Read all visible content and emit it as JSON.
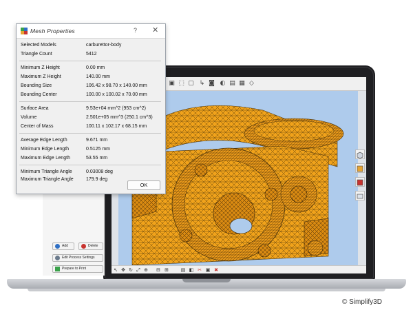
{
  "dialog": {
    "title": "Mesh Properties",
    "help_label": "?",
    "close_label": "✕",
    "ok_label": "OK",
    "rows": [
      {
        "label": "Selected Models",
        "value": "carburettor-body"
      },
      {
        "label": "Triangle Count",
        "value": "5412"
      },
      {
        "label": "Minimum Z Height",
        "value": "0.00 mm"
      },
      {
        "label": "Maximum Z Height",
        "value": "140.00 mm"
      },
      {
        "label": "Bounding Size",
        "value": "106.42 x 98.70 x 140.00 mm"
      },
      {
        "label": "Bounding Center",
        "value": "100.00 x 100.02 x 70.00 mm"
      },
      {
        "label": "Surface Area",
        "value": "9.53e+04 mm^2 (953 cm^2)"
      },
      {
        "label": "Volume",
        "value": "2.501e+05 mm^3 (250.1 cm^3)"
      },
      {
        "label": "Center of Mass",
        "value": "100.11 x 102.17 x 68.15 mm"
      },
      {
        "label": "Average Edge Length",
        "value": "9.671 mm"
      },
      {
        "label": "Minimum Edge Length",
        "value": "0.5125 mm"
      },
      {
        "label": "Maximum Edge Length",
        "value": "53.55 mm"
      },
      {
        "label": "Minimum Triangle Angle",
        "value": "0.03008 deg"
      },
      {
        "label": "Maximum Triangle Angle",
        "value": "179.9 deg"
      }
    ]
  },
  "left_panel": {
    "add_label": "Add",
    "delete_label": "Delete",
    "edit_process_label": "Edit Process Settings",
    "prepare_label": "Prepare to Print"
  },
  "toolbar_icons": [
    "open-icon",
    "cube-view-icon",
    "front-view-icon",
    "axis-icon",
    "camera-icon",
    "shading-icon",
    "cross-section-icon"
  ],
  "bottom_icons": [
    "select-icon",
    "move-icon",
    "rotate-icon",
    "scale-icon",
    "zoom-icon",
    "align-icon",
    "support-icon"
  ],
  "side_icons": [
    "object-icon",
    "layer-view-icon",
    "print-icon",
    "settings-icon"
  ],
  "colors": {
    "viewport_sky": "#aecbec",
    "model_fill": "#f0a21b",
    "model_mesh": "#3a2a10",
    "accent": "#2f6fc4"
  },
  "copyright": "© Simplify3D"
}
